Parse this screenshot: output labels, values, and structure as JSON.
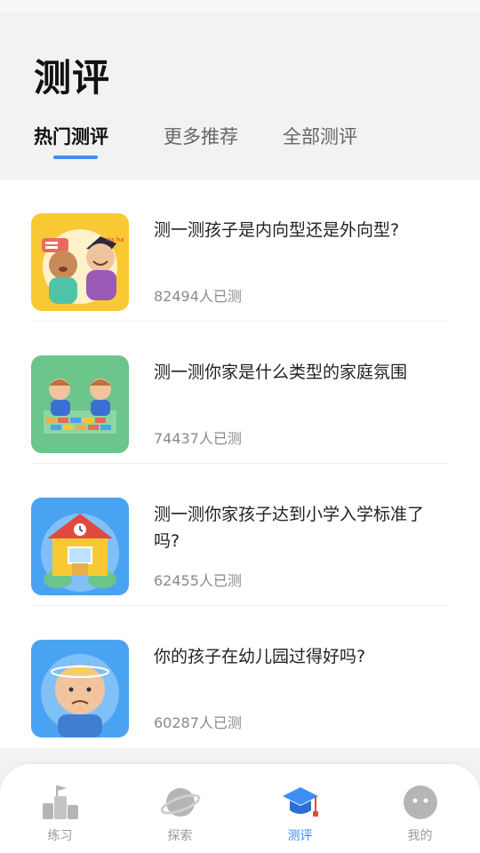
{
  "page": {
    "title": "测评"
  },
  "tabs": [
    {
      "label": "热门测评",
      "active": true
    },
    {
      "label": "更多推荐",
      "active": false
    },
    {
      "label": "全部测评",
      "active": false
    }
  ],
  "assessments": [
    {
      "title": "测一测孩子是内向型还是外向型?",
      "count": "82494人已测",
      "thumb_bg": "#f9c934"
    },
    {
      "title": "测一测你家是什么类型的家庭氛围",
      "count": "74437人已测",
      "thumb_bg": "#6cc58a"
    },
    {
      "title": "测一测你家孩子达到小学入学标准了吗?",
      "count": "62455人已测",
      "thumb_bg": "#4aa3f2"
    },
    {
      "title": "你的孩子在幼儿园过得好吗?",
      "count": "60287人已测",
      "thumb_bg": "#4aa3f2"
    }
  ],
  "bottom_nav": [
    {
      "label": "练习",
      "icon": "practice-icon",
      "active": false
    },
    {
      "label": "探索",
      "icon": "planet-icon",
      "active": false
    },
    {
      "label": "测评",
      "icon": "graduation-cap-icon",
      "active": true
    },
    {
      "label": "我的",
      "icon": "profile-face-icon",
      "active": false
    }
  ],
  "colors": {
    "accent": "#2f8df7",
    "inactive": "#9a9a9a",
    "background": "#f2f2f2"
  }
}
